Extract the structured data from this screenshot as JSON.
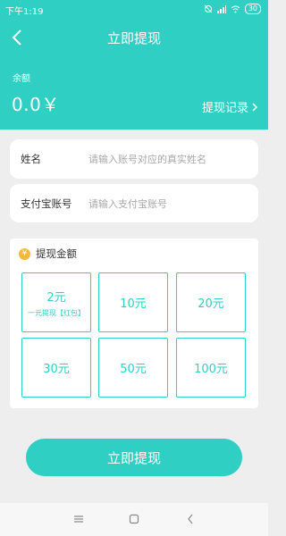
{
  "status": {
    "time": "下午1:19",
    "battery": "30"
  },
  "header": {
    "title": "立即提现",
    "balance_label": "余额",
    "balance_value": "0.0￥",
    "history_label": "提现记录"
  },
  "form": {
    "name_label": "姓名",
    "name_placeholder": "请输入账号对应的真实姓名",
    "alipay_label": "支付宝账号",
    "alipay_placeholder": "请输入支付宝账号"
  },
  "amount": {
    "title": "提现金额",
    "icon_glyph": "¥",
    "options": [
      {
        "value": "2元",
        "sub": "一元提现【红包】"
      },
      {
        "value": "10元"
      },
      {
        "value": "20元"
      },
      {
        "value": "30元"
      },
      {
        "value": "50元"
      },
      {
        "value": "100元"
      }
    ]
  },
  "submit_label": "立即提现",
  "colors": {
    "accent": "#2fd0c3",
    "page_bg": "#eeeeee",
    "coin": "#f5b93a"
  }
}
